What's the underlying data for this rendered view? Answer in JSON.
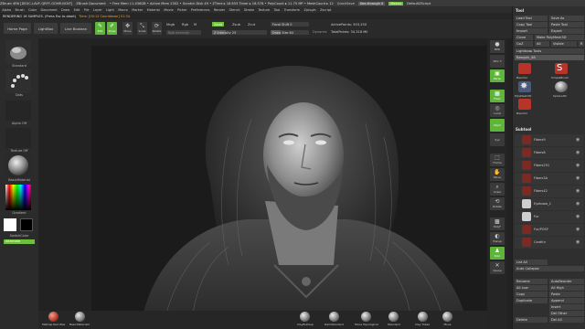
{
  "titlebar": {
    "app": "ZBrush 4R6 [DEUC-LAVF-QRFF-GOHR-NCKF]",
    "doc": "ZBrush Document",
    "mem_free": "• Free Mem 11.436GB • Active Mem 2302 • Scratch Disk 49 • ZTime ▸ 18.653 Timer ▸ 18.578 • PolyCount ▸ 11.75 MP • MeshCount ▸ 12",
    "quicksave": "QuickSave",
    "see_through": "See-through 0",
    "menus": "Menus",
    "default_script": "DefaultZScript"
  },
  "menubar": [
    "Alpha",
    "Brush",
    "Color",
    "Document",
    "Draw",
    "Edit",
    "File",
    "Layer",
    "Light",
    "Macro",
    "Marker",
    "Material",
    "Movie",
    "Picker",
    "Preferences",
    "Render",
    "Stencil",
    "Stroke",
    "Texture",
    "Tool",
    "Transform",
    "Zplugin",
    "Zscript"
  ],
  "status": {
    "render_text": "RENDERING 16 SAMPLES. (Press Esc to abort)",
    "time_text": "Time: [00:12 Countdown] 01:34"
  },
  "shelf": {
    "home_page": "Home Page",
    "lightbox": "LightBox",
    "live_boolean": "Live Boolean",
    "tools": [
      {
        "label": "Edit",
        "icon": "edit-icon",
        "active": true
      },
      {
        "label": "Draw",
        "icon": "draw-icon",
        "active": true
      },
      {
        "label": "Move",
        "icon": "move-icon",
        "active": false
      },
      {
        "label": "Scale",
        "icon": "scale-icon",
        "active": false
      },
      {
        "label": "Rotate",
        "icon": "rotate-icon",
        "active": false
      }
    ],
    "mrgb": "Mrgb",
    "rgb": "Rgb",
    "m": "M",
    "zadd": "Zadd",
    "zsub": "Zsub",
    "zcut": "Zcut",
    "rgb_intensity": "Rgb Intensity",
    "z_intensity": "Z Intensity 25",
    "z_intensity_fraction": 0.25,
    "focal_shift": "Focal Shift 0",
    "draw_size": "Draw Size 64",
    "draw_size_fraction": 0.25,
    "dynamic": "Dynamic",
    "active_points": "ActivePoints: 503,250",
    "total_points": "TotalPoints: 34.318 Mil"
  },
  "leftpanel": {
    "standard": "Standard",
    "dots": "Dots",
    "alpha_off": "Alpha Off",
    "texture_off": "Texture Off",
    "basic_material": "BasicMaterial",
    "gradient": "Gradient",
    "switch_color": "SwitchColor",
    "alternate": "Alternate"
  },
  "rightcol": [
    "BPR",
    "SPix 3",
    "Persp",
    "Floor",
    "Local",
    "LSym",
    "Xyz",
    "Frame",
    "Move",
    "Scale",
    "Rotate",
    "PolyF",
    "Transp",
    "Solo",
    "Xpose"
  ],
  "toolpanel": {
    "title": "Tool",
    "load_tool": "Load Tool",
    "save_as": "Save As",
    "copy_tool": "Copy Tool",
    "paste_tool": "Paste Tool",
    "import": "Import",
    "export": "Export",
    "clone": "Clone",
    "make_polymesh": "Make PolyMesh3D",
    "goz": "GoZ",
    "all": "All",
    "visible": "Visible",
    "r": "R",
    "lightbox_tools": "Lightbox▸ Tools",
    "rasquin": "Rasquin_48",
    "tools": [
      {
        "label": "Bisonfur",
        "color": "#c0302a"
      },
      {
        "label": "SimpleBrush",
        "color": "#c0302a"
      },
      {
        "label": "PolyMesh3D",
        "color": "#8aa0c0"
      },
      {
        "label": "Sphere3D",
        "color": "#999999"
      },
      {
        "label": "Bisonfur",
        "color": "#c0302a"
      }
    ],
    "subtool_head": "Subtool",
    "subtools": [
      "Fibers9",
      "Fibers8",
      "Fibers251",
      "Fibers3A",
      "Fibers42",
      "Eyebrow_1",
      "Fur",
      "Fur/POSY",
      "Cardfur"
    ],
    "list_all": "List All",
    "auto_collapse": "Auto Collapse",
    "rename": "Rename",
    "autoreorder": "AutoReorder",
    "all_low": "All Low",
    "all_high": "All High",
    "copy": "Copy",
    "paste": "Paste",
    "duplicate": "Duplicate",
    "append": "Append",
    "insert": "Insert",
    "del_other": "Del Other",
    "delete": "Delete",
    "del_all": "Del All"
  },
  "bottomshelf": [
    {
      "label": "MatCap Red Wax",
      "color": "#b03a2a"
    },
    {
      "label": "BasicMaterial2",
      "color": "#888888"
    },
    {
      "label": "ClayBuildup",
      "color": "#cccccc"
    },
    {
      "label": "DamStandard",
      "color": "#cccccc"
    },
    {
      "label": "Move Topological",
      "color": "#cccccc"
    },
    {
      "label": "Standard",
      "color": "#cccccc"
    },
    {
      "label": "Clay Tubes",
      "color": "#cccccc"
    },
    {
      "label": "Move",
      "color": "#cccccc"
    }
  ],
  "colors": {
    "accent_green": "#6fbf3a",
    "time_orange": "#e8a43c",
    "material_red": "#b03a2a"
  }
}
